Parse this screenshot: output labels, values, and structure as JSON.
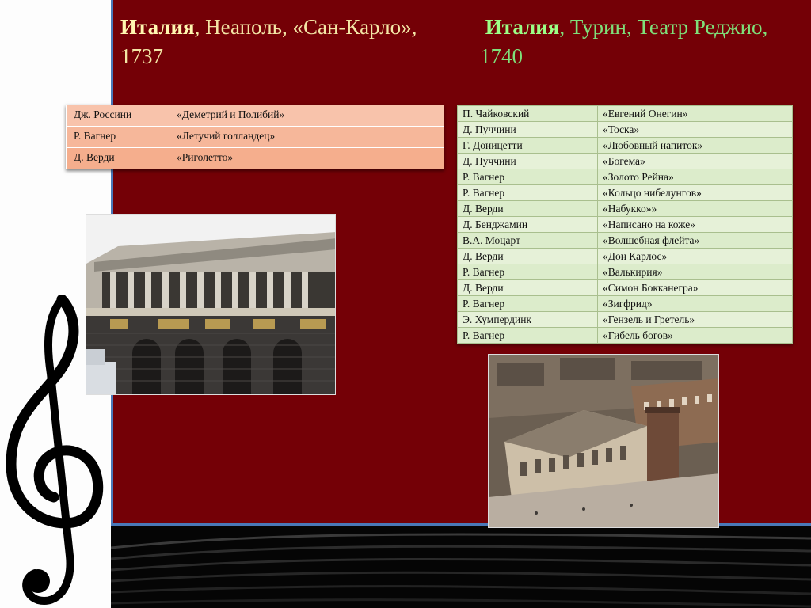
{
  "slide": {
    "naples": {
      "country": "Италия",
      "rest": ", Неаполь, «Сан-Карло», 1737",
      "rows": [
        {
          "composer": "Дж. Россини",
          "opera": "«Деметрий и Полибий»"
        },
        {
          "composer": "Р. Вагнер",
          "opera": "«Летучий голландец»"
        },
        {
          "composer": "Д. Верди",
          "opera": "«Риголетто»"
        }
      ]
    },
    "turin": {
      "country": "Италия",
      "rest": ", Турин, Театр Реджио, 1740",
      "rows": [
        {
          "composer": "П. Чайковский",
          "opera": "«Евгений Онегин»"
        },
        {
          "composer": "Д. Пуччини",
          "opera": "«Тоска»"
        },
        {
          "composer": "Г. Доницетти",
          "opera": "«Любовный напиток»"
        },
        {
          "composer": "Д. Пуччини",
          "opera": "«Богема»"
        },
        {
          "composer": "Р. Вагнер",
          "opera": "«Золото Рейна»"
        },
        {
          "composer": "Р. Вагнер",
          "opera": "«Кольцо нибелунгов»"
        },
        {
          "composer": "Д. Верди",
          "opera": "«Набукко»»"
        },
        {
          "composer": "Д. Бенджамин",
          "opera": "«Написано на коже»"
        },
        {
          "composer": "В.А. Моцарт",
          "opera": "«Волшебная флейта»"
        },
        {
          "composer": "Д. Верди",
          "opera": "«Дон Карлос»"
        },
        {
          "composer": "Р. Вагнер",
          "opera": "«Валькирия»"
        },
        {
          "composer": "Д. Верди",
          "opera": "«Симон Бокканегра»"
        },
        {
          "composer": "Р. Вагнер",
          "opera": "«Зигфрид»"
        },
        {
          "composer": "Э. Хумпердинк",
          "opera": "«Гензель и Гретель»"
        },
        {
          "composer": "Р. Вагнер",
          "opera": "«Гибель богов»"
        }
      ]
    },
    "colors": {
      "panel": "#740006",
      "naples_table": "#f6b79a",
      "turin_table": "#e6f1d8",
      "heading_turin": "#7fe07a",
      "heading_naples": "#f3e6a6"
    },
    "icons": [
      "treble-clef-icon"
    ]
  }
}
